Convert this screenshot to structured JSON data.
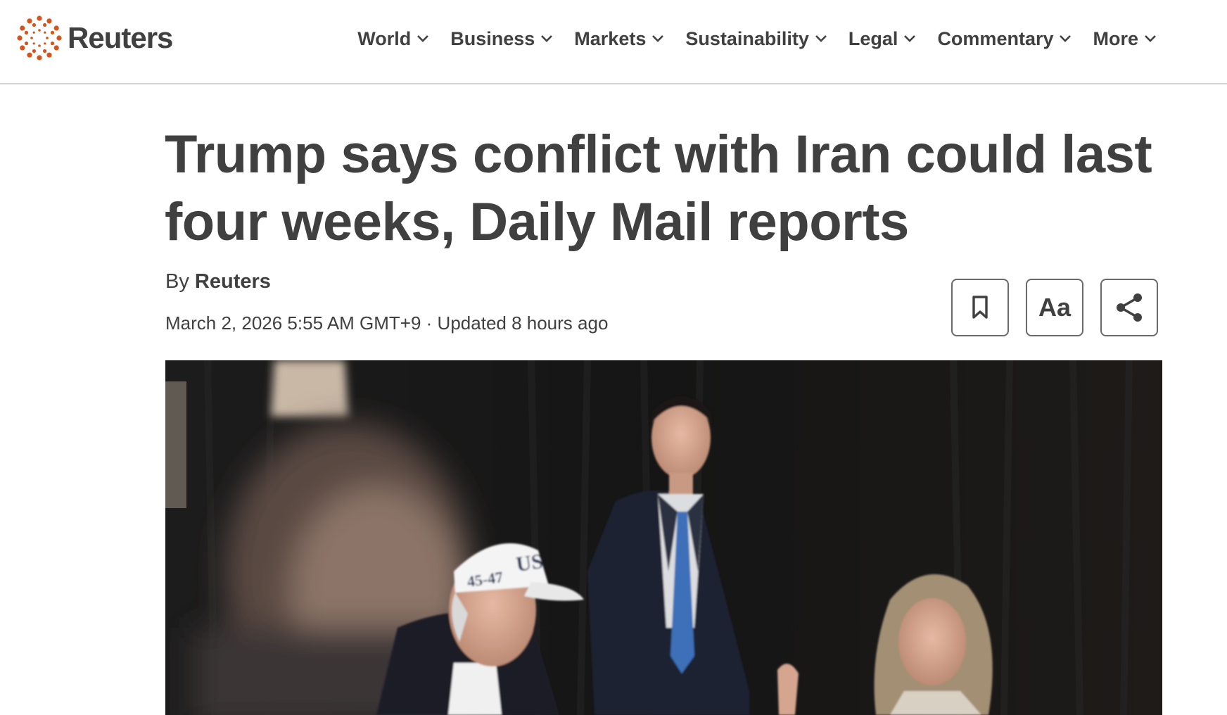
{
  "brand": {
    "name": "Reuters",
    "accent_color": "#fa6400",
    "logo_icon": "reuters-dot-ring-logo"
  },
  "nav": {
    "items": [
      {
        "label": "World",
        "icon": "chevron-down-icon"
      },
      {
        "label": "Business",
        "icon": "chevron-down-icon"
      },
      {
        "label": "Markets",
        "icon": "chevron-down-icon"
      },
      {
        "label": "Sustainability",
        "icon": "chevron-down-icon"
      },
      {
        "label": "Legal",
        "icon": "chevron-down-icon"
      },
      {
        "label": "Commentary",
        "icon": "chevron-down-icon"
      },
      {
        "label": "More",
        "icon": "chevron-down-icon"
      }
    ]
  },
  "article": {
    "headline": "Trump says conflict with Iran could last four weeks, Daily Mail reports",
    "byline_prefix": "By",
    "author": "Reuters",
    "dateline": "March 2, 2026 5:55 AM GMT+9 · Updated 8 hours ago",
    "photo": {
      "cap_text_front": "45-47",
      "cap_text_side": "US"
    }
  },
  "actions": {
    "bookmark_icon": "bookmark-icon",
    "font_size_label": "Aa",
    "share_icon": "share-icon"
  }
}
